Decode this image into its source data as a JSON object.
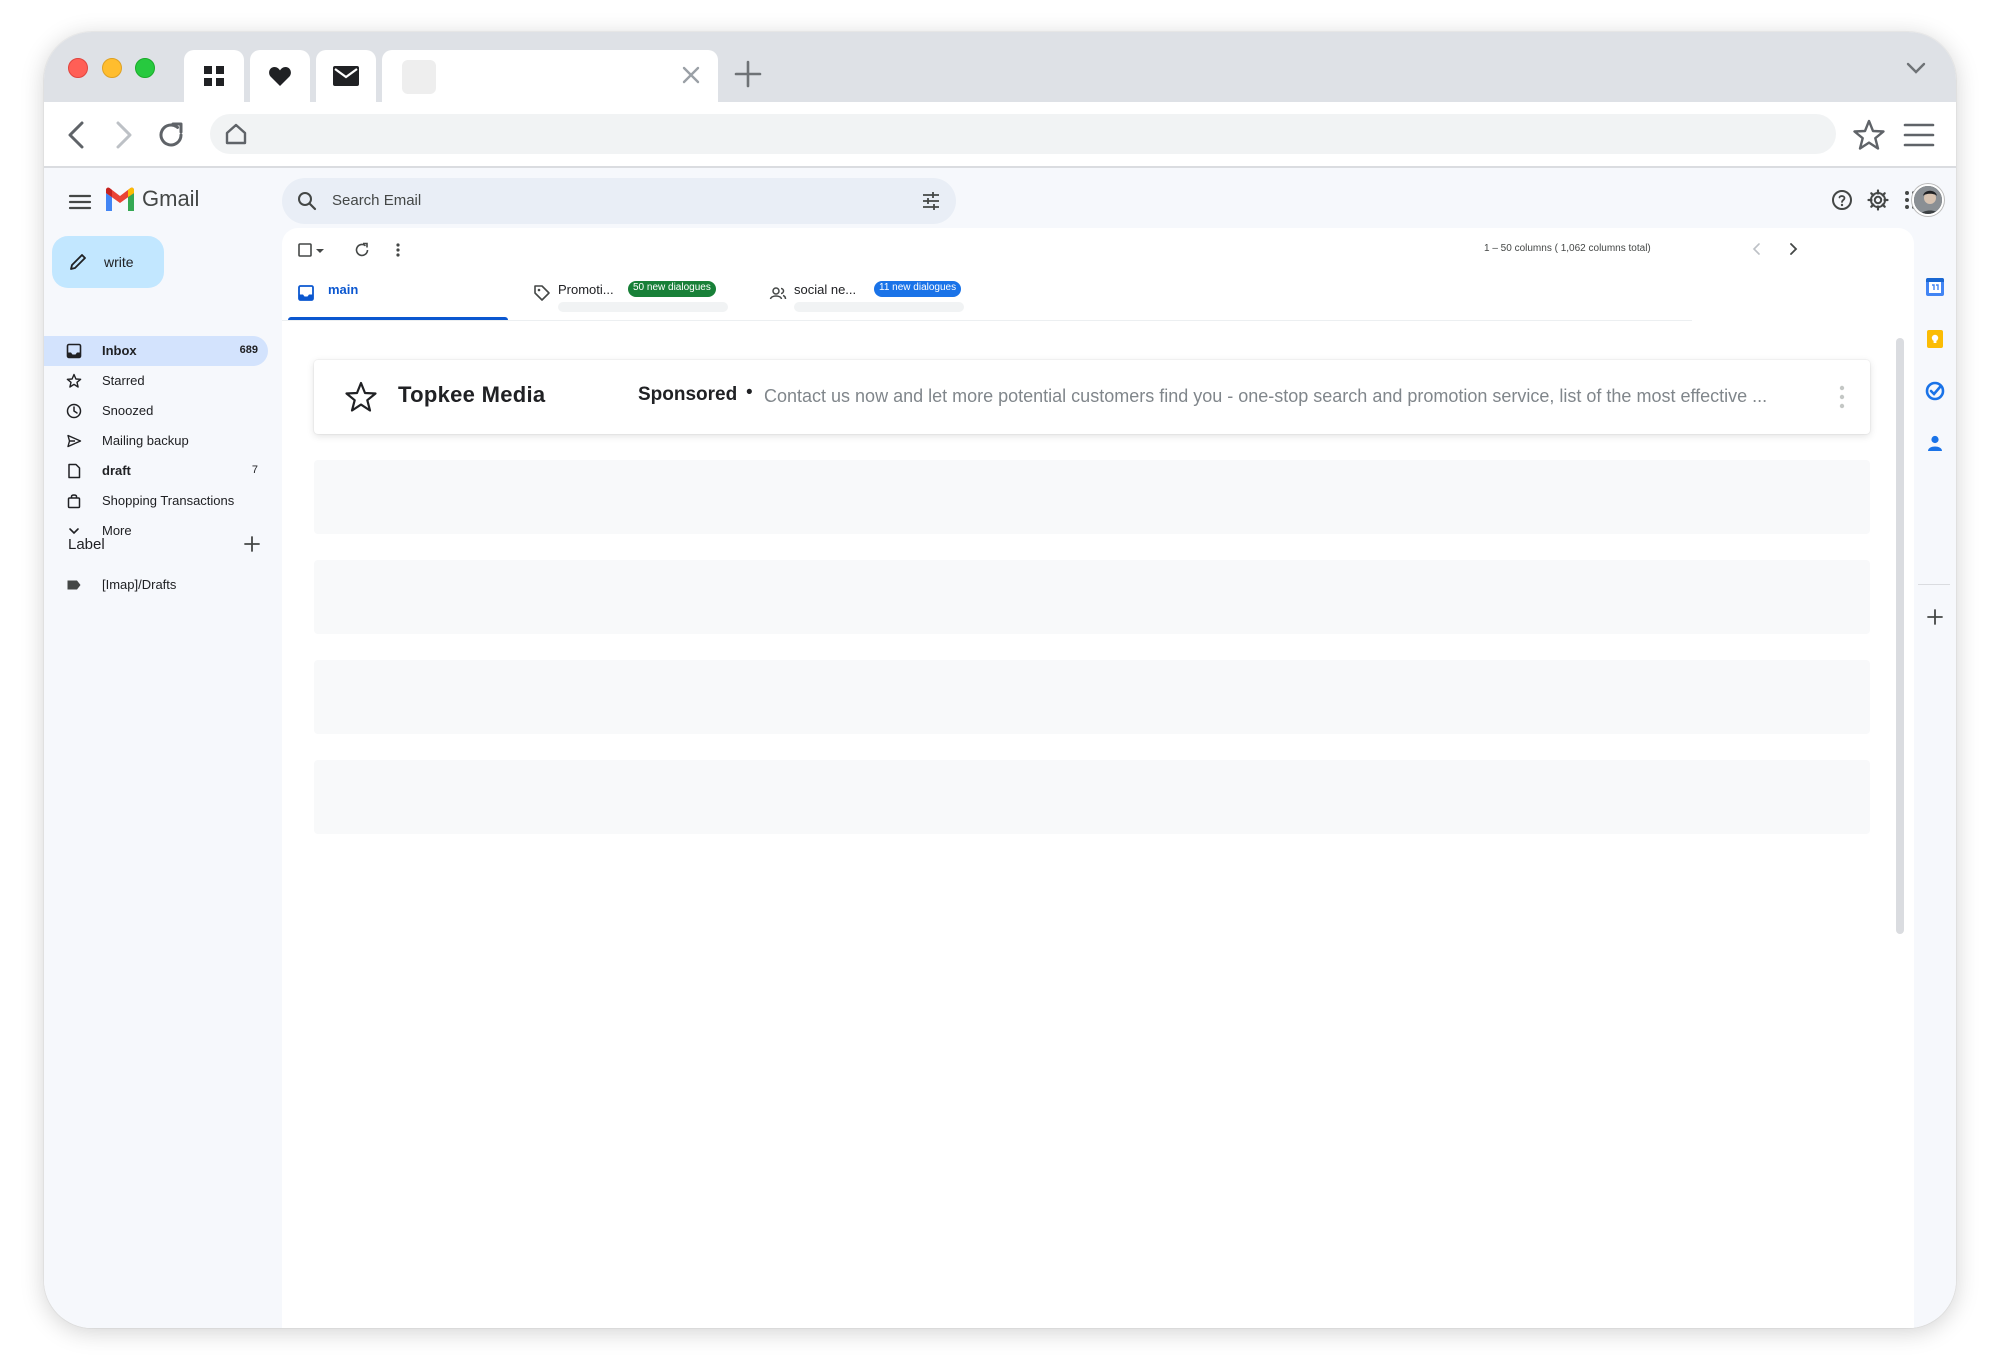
{
  "browser": {
    "pinned_tabs": [
      {
        "icon": "grid-icon"
      },
      {
        "icon": "heart-icon"
      },
      {
        "icon": "mail-icon"
      }
    ],
    "active_tab": {
      "title": ""
    },
    "address_bar": {
      "value": ""
    }
  },
  "gmail": {
    "brand": "Gmail",
    "search": {
      "placeholder": "Search Email"
    },
    "compose_label": "write",
    "nav": [
      {
        "label": "Inbox",
        "count": "689",
        "icon": "inbox-icon",
        "active": true,
        "bold": true
      },
      {
        "label": "Starred",
        "count": "",
        "icon": "star-icon"
      },
      {
        "label": "Snoozed",
        "count": "",
        "icon": "clock-icon"
      },
      {
        "label": "Mailing backup",
        "count": "",
        "icon": "send-icon"
      },
      {
        "label": "draft",
        "count": "7",
        "icon": "draft-icon",
        "bold": true
      },
      {
        "label": "Shopping Transactions",
        "count": "",
        "icon": "shopping-bag-icon"
      },
      {
        "label": "More",
        "count": "",
        "icon": "chevron-down-icon"
      }
    ],
    "labels_heading": "Label",
    "labels": [
      {
        "label": "[Imap]/Drafts",
        "icon": "label-icon"
      }
    ],
    "pager_text": "1 – 50 columns ( 1,062 columns total)",
    "tabs": [
      {
        "label": "main",
        "icon": "inbox-icon",
        "active": true
      },
      {
        "label": "Promoti...",
        "badge": "50 new dialogues",
        "badge_color": "#188038",
        "icon": "tag-icon"
      },
      {
        "label": "social ne...",
        "badge": "11 new dialogues",
        "badge_color": "#1a73e8",
        "icon": "people-icon"
      }
    ],
    "ad": {
      "sender": "Topkee Media",
      "sponsored": "Sponsored",
      "separator": "•",
      "snippet": "Contact us now and let more potential customers find you - one-stop search and promotion service, list of the most effective ..."
    },
    "loading_rows": 4,
    "colors": {
      "accent": "#0b57d0",
      "compose_bg": "#c2e7ff",
      "active_nav_bg": "#d3e3fd",
      "app_bg": "#f6f8fc"
    }
  }
}
